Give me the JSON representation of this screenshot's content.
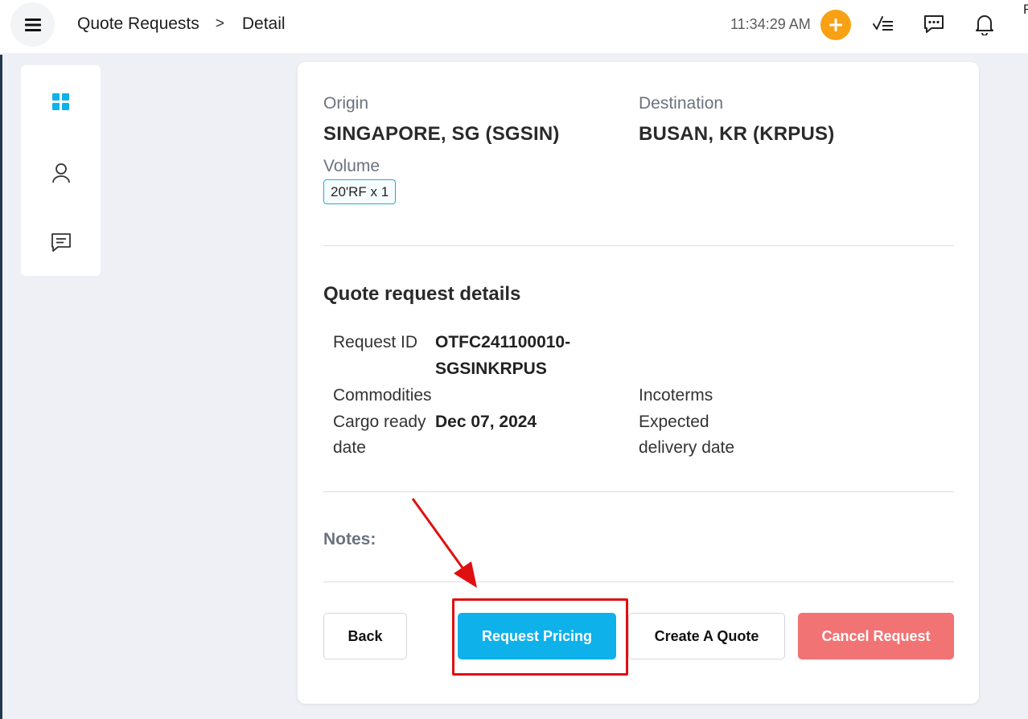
{
  "header": {
    "breadcrumb": [
      "Quote Requests",
      ">",
      "Detail"
    ],
    "time": "11:34:29 AM",
    "corner_text": "F",
    "icons": [
      "menu-icon",
      "plus-icon",
      "checklist-icon",
      "chat-icon",
      "bell-icon"
    ]
  },
  "sidebar": {
    "items": [
      {
        "icon": "dashboard-icon",
        "active": true
      },
      {
        "icon": "user-icon",
        "active": false
      },
      {
        "icon": "message-icon",
        "active": false
      }
    ]
  },
  "shipment": {
    "origin_label": "Origin",
    "origin_value": "SINGAPORE, SG (SGSIN)",
    "destination_label": "Destination",
    "destination_value": "BUSAN, KR (KRPUS)",
    "volume_label": "Volume",
    "volume_value": "20'RF x 1"
  },
  "details": {
    "title": "Quote request details",
    "request_id_label": "Request ID",
    "request_id_line1": "OTFC241100010-",
    "request_id_line2": "SGSINKRPUS",
    "commodities_label": "Commodities",
    "incoterms_label": "Incoterms",
    "cargo_ready_label_line1": "Cargo ready",
    "cargo_ready_label_line2": "date",
    "cargo_ready_value": "Dec 07, 2024",
    "expected_delivery_label_line1": "Expected",
    "expected_delivery_label_line2": "delivery date"
  },
  "notes": {
    "label": "Notes:"
  },
  "actions": {
    "back": "Back",
    "request_pricing": "Request Pricing",
    "create_quote": "Create A Quote",
    "cancel_request": "Cancel Request"
  },
  "colors": {
    "accent": "#0fb1ea",
    "plus": "#f8a114",
    "cancel": "#f17373",
    "annotation": "#e01010"
  }
}
